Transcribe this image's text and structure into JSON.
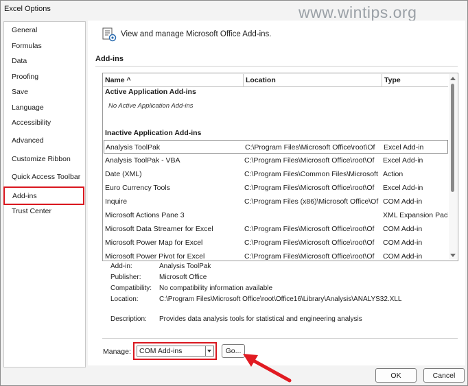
{
  "window": {
    "title": "Excel Options",
    "watermark": "www.wintips.org"
  },
  "sidebar": {
    "items": [
      {
        "label": "General"
      },
      {
        "label": "Formulas"
      },
      {
        "label": "Data"
      },
      {
        "label": "Proofing"
      },
      {
        "label": "Save"
      },
      {
        "label": "Language"
      },
      {
        "label": "Accessibility"
      },
      {
        "label": "Advanced"
      },
      {
        "label": "Customize Ribbon"
      },
      {
        "label": "Quick Access Toolbar"
      },
      {
        "label": "Add-ins",
        "selected": true
      },
      {
        "label": "Trust Center"
      }
    ]
  },
  "header": {
    "icon": "addins-gear-icon",
    "text": "View and manage Microsoft Office Add-ins."
  },
  "section": {
    "label": "Add-ins"
  },
  "table": {
    "columns": [
      "Name ^",
      "Location",
      "Type"
    ],
    "active_group": "Active Application Add-ins",
    "active_none": "No Active Application Add-ins",
    "inactive_group": "Inactive Application Add-ins",
    "rows": [
      {
        "name": "Analysis ToolPak",
        "location": "C:\\Program Files\\Microsoft Office\\root\\Of",
        "type": "Excel Add-in"
      },
      {
        "name": "Analysis ToolPak - VBA",
        "location": "C:\\Program Files\\Microsoft Office\\root\\Of",
        "type": "Excel Add-in"
      },
      {
        "name": "Date (XML)",
        "location": "C:\\Program Files\\Common Files\\Microsoft",
        "type": "Action"
      },
      {
        "name": "Euro Currency Tools",
        "location": "C:\\Program Files\\Microsoft Office\\root\\Of",
        "type": "Excel Add-in"
      },
      {
        "name": "Inquire",
        "location": "C:\\Program Files (x86)\\Microsoft Office\\Of",
        "type": "COM Add-in"
      },
      {
        "name": "Microsoft Actions Pane 3",
        "location": "",
        "type": "XML Expansion Pack"
      },
      {
        "name": "Microsoft Data Streamer for Excel",
        "location": "C:\\Program Files\\Microsoft Office\\root\\Of",
        "type": "COM Add-in"
      },
      {
        "name": "Microsoft Power Map for Excel",
        "location": "C:\\Program Files\\Microsoft Office\\root\\Of",
        "type": "COM Add-in"
      },
      {
        "name": "Microsoft Power Pivot for Excel",
        "location": "C:\\Program Files\\Microsoft Office\\root\\Of",
        "type": "COM Add-in"
      }
    ]
  },
  "details": {
    "addin_label": "Add-in:",
    "addin_value": "Analysis ToolPak",
    "publisher_label": "Publisher:",
    "publisher_value": "Microsoft Office",
    "compat_label": "Compatibility:",
    "compat_value": "No compatibility information available",
    "location_label": "Location:",
    "location_value": "C:\\Program Files\\Microsoft Office\\root\\Office16\\Library\\Analysis\\ANALYS32.XLL",
    "desc_label": "Description:",
    "desc_value": "Provides data analysis tools for statistical and engineering analysis"
  },
  "manage": {
    "label": "Manage:",
    "selected": "COM Add-ins",
    "go_label": "Go..."
  },
  "footer": {
    "ok_label": "OK",
    "cancel_label": "Cancel"
  },
  "colors": {
    "highlight_red": "#d9161e",
    "arrow_red": "#e11b22"
  }
}
